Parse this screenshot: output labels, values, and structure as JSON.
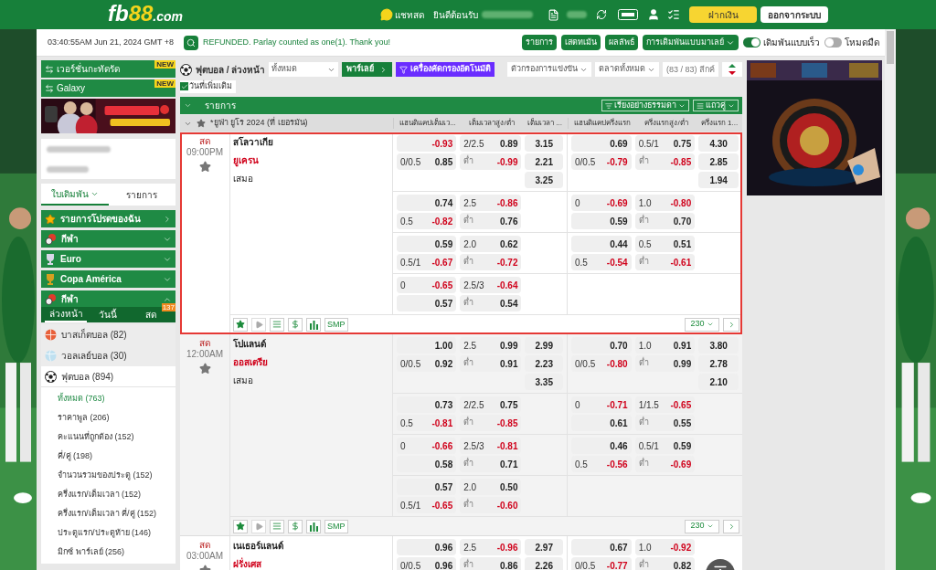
{
  "header": {
    "logo": [
      "fb",
      "88",
      ".com"
    ],
    "chat": "แชทสด",
    "welcome": "ยินดีต้อนรับ",
    "deposit": "ฝากเงิน",
    "logout": "ออกจากระบบ"
  },
  "topbar": {
    "clock": "03:40:55AM Jun 21, 2024 GMT +8",
    "message": "REFUNDED. Parlay counted as one(1). Thank you!",
    "buttons": [
      {
        "label": "รายการ",
        "dropdown": false
      },
      {
        "label": "เสตทเม้น",
        "dropdown": false
      },
      {
        "label": "ผลลัพธ์",
        "dropdown": false
      },
      {
        "label": "การเดิมพันแบบมาเลย์",
        "dropdown": true
      }
    ],
    "toggles": [
      {
        "label": "เดิมพันแบบเร็ว",
        "on": true
      },
      {
        "label": "โหมดมืด",
        "on": false
      }
    ]
  },
  "sidebar": {
    "versions": [
      {
        "label": "เวอร์ชั่นกะทัดรัด",
        "badge": "NEW"
      },
      {
        "label": "Galaxy",
        "badge": "NEW"
      }
    ],
    "tabs": [
      {
        "label": "ใบเดิมพัน",
        "selected": true,
        "dropdown": true
      },
      {
        "label": "รายการ",
        "selected": false,
        "dropdown": false
      }
    ],
    "categories": [
      {
        "label": "รายการโปรดของฉัน",
        "kind": "star"
      },
      {
        "label": "กีฬา",
        "kind": "sport",
        "expanded": false
      },
      {
        "label": "Euro",
        "kind": "trophy",
        "expanded": false
      },
      {
        "label": "Copa América",
        "kind": "cup",
        "expanded": false
      },
      {
        "label": "กีฬา",
        "kind": "sport",
        "expanded": true
      }
    ],
    "subtabs": [
      {
        "label": "ล่วงหน้า",
        "selected": true
      },
      {
        "label": "วันนี้",
        "selected": false
      },
      {
        "label": "สด",
        "selected": false,
        "badge": "137"
      }
    ],
    "sports": [
      {
        "label": "บาสเก็ตบอล (82)",
        "kind": "basketball",
        "expanded": false
      },
      {
        "label": "วอลเลย์บอล (30)",
        "kind": "volleyball",
        "expanded": false
      },
      {
        "label": "ฟุตบอล (894)",
        "kind": "football",
        "expanded": true,
        "children": [
          {
            "label": "ทั้งหมด (763)",
            "selected": true
          },
          {
            "label": "ราคาพูล (206)",
            "selected": false
          },
          {
            "label": "คะแนนที่ถูกต้อง (152)",
            "selected": false
          },
          {
            "label": "คี่/คู่ (198)",
            "selected": false
          },
          {
            "label": "จำนวนรวมของประตู (152)",
            "selected": false
          },
          {
            "label": "ครึ่งแรก/เต็มเวลา (152)",
            "selected": false
          },
          {
            "label": "ครึ่งแรก/เต็มเวลา คี่/คู่ (152)",
            "selected": false
          },
          {
            "label": "ประตูแรก/ประตูท้าย (146)",
            "selected": false
          },
          {
            "label": "มิกซ์ พาร์เลย์ (256)",
            "selected": false
          }
        ]
      }
    ]
  },
  "filters": {
    "title": "ฟุตบอล / ล่วงหน้า",
    "select": "ทั้งหมด",
    "parlay": "พาร์เลย์",
    "auto_filter": "เครื่องคัดกรองอัตโนมัติ",
    "dropdowns": [
      "ตัวกรองการแข่งขัน",
      "ตลาดทั้งหมด"
    ],
    "league_count": "(83 / 83) ลีกค์",
    "extra_dates": {
      "label": "วันที่เพิ่มเติม",
      "checked": true
    }
  },
  "table": {
    "title": "รายการ",
    "sort": "เรียงอย่างธรรมดา",
    "view": "แถวคู่",
    "league": "*ยูฟ่า ยูโร 2024 (ที่ เยอรมัน)",
    "columns": [
      "แฮนดิแคปเต็มเว...",
      "เต็มเวลาสูง/ต่ำ",
      "เต็มเวลา ...",
      "แฮนดิแคปครึ่งแรก",
      "ครึ่งแรกสูง/ต่ำ",
      "ครึ่งแรก 1..."
    ],
    "matches": [
      {
        "status": "สด",
        "time": "09:00PM",
        "favorite": false,
        "selected": true,
        "teams": [
          {
            "name": "สโลวาเกีย",
            "favored": false
          },
          {
            "name": "ยูเครน",
            "favored": true
          }
        ],
        "draw": "เสมอ",
        "groups": [
          {
            "hdp": [
              {
                "odds": "-0.93"
              },
              {
                "line": "0/0.5",
                "odds": "0.85"
              }
            ],
            "ou": [
              {
                "line": "2/2.5",
                "odds": "0.89"
              },
              {
                "line": "ต่ำ",
                "odds": "-0.99"
              }
            ],
            "x12": [
              "3.15",
              "2.21",
              "3.25"
            ],
            "h1_hdp": [
              {
                "odds": "0.69"
              },
              {
                "line": "0/0.5",
                "odds": "-0.79"
              }
            ],
            "h1_ou": [
              {
                "line": "0.5/1",
                "odds": "0.75"
              },
              {
                "line": "ต่ำ",
                "odds": "-0.85"
              }
            ],
            "h1_x12": [
              "4.30",
              "2.85",
              "1.94"
            ]
          },
          {
            "hdp": [
              {
                "odds": "0.74"
              },
              {
                "line": "0.5",
                "odds": "-0.82"
              }
            ],
            "ou": [
              {
                "line": "2.5",
                "odds": "-0.86"
              },
              {
                "line": "ต่ำ",
                "odds": "0.76"
              }
            ],
            "h1_hdp": [
              {
                "line": "0",
                "odds": "-0.69"
              },
              {
                "odds": "0.59"
              }
            ],
            "h1_ou": [
              {
                "line": "1.0",
                "odds": "-0.80"
              },
              {
                "line": "ต่ำ",
                "odds": "0.70"
              }
            ]
          },
          {
            "hdp": [
              {
                "odds": "0.59"
              },
              {
                "line": "0.5/1",
                "odds": "-0.67"
              }
            ],
            "ou": [
              {
                "line": "2.0",
                "odds": "0.62"
              },
              {
                "line": "ต่ำ",
                "odds": "-0.72"
              }
            ],
            "h1_hdp": [
              {
                "odds": "0.44"
              },
              {
                "line": "0.5",
                "odds": "-0.54"
              }
            ],
            "h1_ou": [
              {
                "line": "0.5",
                "odds": "0.51"
              },
              {
                "line": "ต่ำ",
                "odds": "-0.61"
              }
            ]
          },
          {
            "hdp": [
              {
                "line": "0",
                "odds": "-0.65"
              },
              {
                "odds": "0.57"
              }
            ],
            "ou": [
              {
                "line": "2.5/3",
                "odds": "-0.64"
              },
              {
                "line": "ต่ำ",
                "odds": "0.54"
              }
            ]
          }
        ],
        "footer": {
          "smp": "SMP",
          "count": "230"
        }
      },
      {
        "status": "สด",
        "time": "12:00AM",
        "favorite": false,
        "selected": false,
        "teams": [
          {
            "name": "โปแลนด์",
            "favored": false
          },
          {
            "name": "ออสเตรีย",
            "favored": true
          }
        ],
        "draw": "เสมอ",
        "groups": [
          {
            "hdp": [
              {
                "odds": "1.00"
              },
              {
                "line": "0/0.5",
                "odds": "0.92"
              }
            ],
            "ou": [
              {
                "line": "2.5",
                "odds": "0.99"
              },
              {
                "line": "ต่ำ",
                "odds": "0.91"
              }
            ],
            "x12": [
              "2.99",
              "2.23",
              "3.35"
            ],
            "h1_hdp": [
              {
                "odds": "0.70"
              },
              {
                "line": "0/0.5",
                "odds": "-0.80"
              }
            ],
            "h1_ou": [
              {
                "line": "1.0",
                "odds": "0.91"
              },
              {
                "line": "ต่ำ",
                "odds": "0.99"
              }
            ],
            "h1_x12": [
              "3.80",
              "2.78",
              "2.10"
            ]
          },
          {
            "hdp": [
              {
                "odds": "0.73"
              },
              {
                "line": "0.5",
                "odds": "-0.81"
              }
            ],
            "ou": [
              {
                "line": "2/2.5",
                "odds": "0.75"
              },
              {
                "line": "ต่ำ",
                "odds": "-0.85"
              }
            ],
            "h1_hdp": [
              {
                "line": "0",
                "odds": "-0.71"
              },
              {
                "odds": "0.61"
              }
            ],
            "h1_ou": [
              {
                "line": "1/1.5",
                "odds": "-0.65"
              },
              {
                "line": "ต่ำ",
                "odds": "0.55"
              }
            ]
          },
          {
            "hdp": [
              {
                "line": "0",
                "odds": "-0.66"
              },
              {
                "odds": "0.58"
              }
            ],
            "ou": [
              {
                "line": "2.5/3",
                "odds": "-0.81"
              },
              {
                "line": "ต่ำ",
                "odds": "0.71"
              }
            ],
            "h1_hdp": [
              {
                "odds": "0.46"
              },
              {
                "line": "0.5",
                "odds": "-0.56"
              }
            ],
            "h1_ou": [
              {
                "line": "0.5/1",
                "odds": "0.59"
              },
              {
                "line": "ต่ำ",
                "odds": "-0.69"
              }
            ]
          },
          {
            "hdp": [
              {
                "odds": "0.57"
              },
              {
                "line": "0.5/1",
                "odds": "-0.65"
              }
            ],
            "ou": [
              {
                "line": "2.0",
                "odds": "0.50"
              },
              {
                "line": "ต่ำ",
                "odds": "-0.60"
              }
            ]
          }
        ],
        "footer": {
          "smp": "SMP",
          "count": "230"
        }
      },
      {
        "status": "สด",
        "time": "03:00AM",
        "favorite": false,
        "selected": false,
        "teams": [
          {
            "name": "เนเธอร์แลนด์",
            "favored": false
          },
          {
            "name": "ฝรั่งเศส",
            "favored": true
          }
        ],
        "groups": [
          {
            "hdp": [
              {
                "odds": "0.96"
              },
              {
                "line": "0/0.5",
                "odds": "0.96"
              }
            ],
            "ou": [
              {
                "line": "2.5",
                "odds": "-0.96"
              },
              {
                "line": "ต่ำ",
                "odds": "0.86"
              }
            ],
            "x12": [
              "2.97",
              "2.26"
            ],
            "h1_hdp": [
              {
                "odds": "0.67"
              },
              {
                "line": "0/0.5",
                "odds": "-0.77"
              }
            ],
            "h1_ou": [
              {
                "line": "1.0",
                "odds": "-0.92"
              },
              {
                "line": "ต่ำ",
                "odds": "0.82"
              }
            ]
          }
        ]
      }
    ]
  }
}
